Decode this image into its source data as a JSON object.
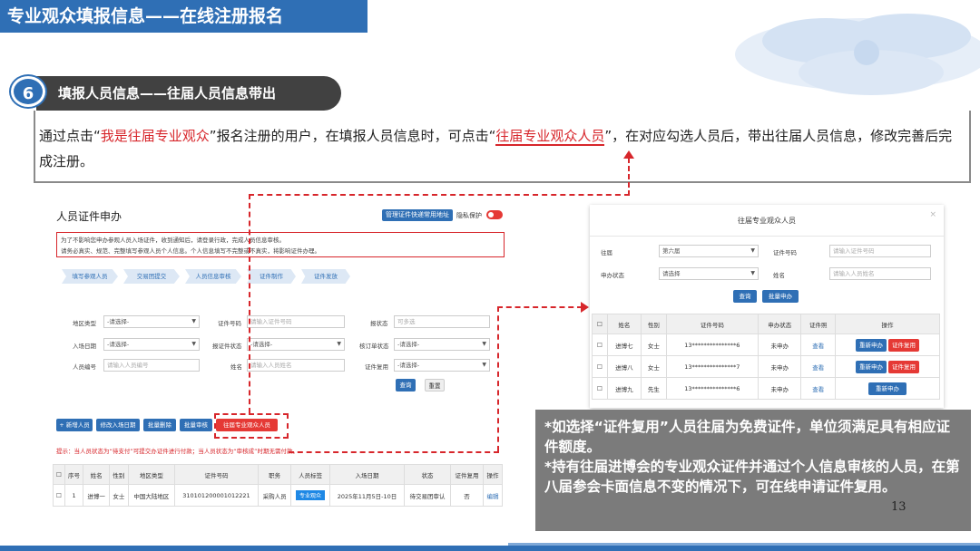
{
  "header": {
    "title": "专业观众填报信息——在线注册报名"
  },
  "step": {
    "number": "6",
    "title": "填报人员信息——往届人员信息带出"
  },
  "description": {
    "part1": "通过点击“",
    "highlight1": "我是往届专业观众",
    "part2": "”报名注册的用户，在填报人员信息时，可点击“",
    "highlight2": "往届专业观众人员",
    "part3": "”，在对应勾选人员后，带出往届人员信息，修改完善后完成注册。"
  },
  "left_panel": {
    "title": "人员证件申办",
    "addr_button": "管理证件快递常用地址",
    "privacy_label": "隐私保护",
    "notice_line1": "为了不影响您申办参观人员入场证件，收到通知后，请登录行政，完成人员信息审核。",
    "notice_line2": "请务必真实、规范、完整填写参观人员个人信息。个人信息填写不完整或不真实，将影响证件办理。",
    "steps": [
      "填写参观人员",
      "交易团提交",
      "人员信息审核",
      "证件制作",
      "证件发放"
    ],
    "form": {
      "region_label": "地区类型",
      "region_value": "-请选择-",
      "id_label": "证件号码",
      "id_placeholder": "请输入证件号码",
      "status_label": "报状态",
      "status_value": "可多选",
      "entry_label": "入场日期",
      "entry_value": "-请选择-",
      "cert_status_label": "报证件状态",
      "cert_status_value": "-请选择-",
      "review_label": "核订单状态",
      "review_value": "-请选择-",
      "person_no_label": "人员编号",
      "person_no_placeholder": "请输入人员编号",
      "name_label": "姓名",
      "name_placeholder": "请输入人员姓名",
      "reuse_label": "证件复用",
      "reuse_value": "-请选择-",
      "query_button": "查询",
      "reset_button": "重置"
    },
    "actions": [
      "+ 新增人员",
      "修改入场日期",
      "批量删除",
      "批量审核"
    ],
    "past_visitor_button": "往届专业观众人员",
    "hint": "提示：当人员状态为“待支付”可提交办证件进行付款；当人员状态为“审核成”时期无需付款。",
    "table": {
      "headers": [
        "",
        "序号",
        "姓名",
        "性别",
        "地区类型",
        "证件号码",
        "职务",
        "人员标签",
        "入场日期",
        "状态",
        "证件复用",
        "操作"
      ],
      "rows": [
        [
          "",
          "1",
          "进博一",
          "女士",
          "中国大陆地区",
          "310101200001012221",
          "采购人员",
          "专业观众",
          "2025年11月5日-10日",
          "待交易团审认",
          "否",
          "编辑"
        ]
      ]
    }
  },
  "right_panel": {
    "title": "往届专业观众人员",
    "close": "×",
    "session_label": "往届",
    "session_value": "第六届",
    "cert_no_label": "证件号码",
    "cert_no_placeholder": "请输入证件号码",
    "apply_status_label": "申办状态",
    "apply_status_value": "请选择",
    "name_label": "姓名",
    "name_placeholder": "请输入人员姓名",
    "query_button": "查询",
    "batch_button": "批量申办",
    "table": {
      "headers": [
        "",
        "姓名",
        "性别",
        "证件号码",
        "申办状态",
        "证件照",
        "操作"
      ],
      "rows": [
        {
          "name": "进博七",
          "gender": "女士",
          "cert": "13***************6",
          "status": "未申办",
          "photo": "查看",
          "actions": [
            "重新申办",
            "证件复用"
          ]
        },
        {
          "name": "进博八",
          "gender": "女士",
          "cert": "13***************7",
          "status": "未申办",
          "photo": "查看",
          "actions": [
            "重新申办",
            "证件复用"
          ]
        },
        {
          "name": "进博九",
          "gender": "先生",
          "cert": "13***************6",
          "status": "未申办",
          "photo": "查看",
          "actions": [
            "重新申办"
          ]
        }
      ]
    }
  },
  "callout": {
    "line1": "*如选择“证件复用”人员往届为免费证件，单位须满足具有相应证件额度。",
    "line2": "*持有往届进博会的专业观众证件并通过个人信息审核的人员，在第八届参会卡面信息不变的情况下，可在线申请证件复用。"
  },
  "page_number": "13",
  "colors": {
    "brand_blue": "#2f6fb5",
    "accent_red": "#d7262b",
    "callout_gray": "#7b7b7b"
  }
}
